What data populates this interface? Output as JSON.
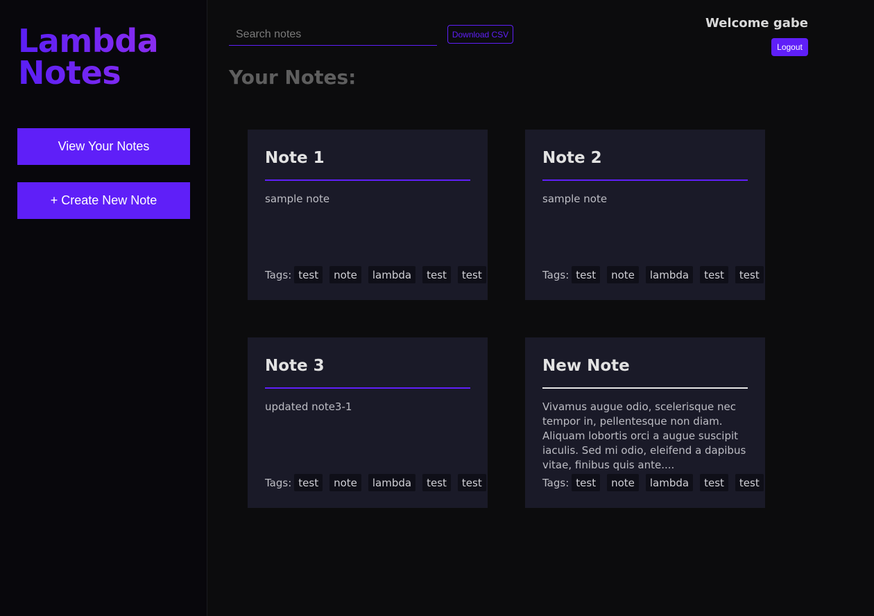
{
  "sidebar": {
    "logo_line1": "Lambda",
    "logo_line2": "Notes",
    "view_notes_label": "View Your Notes",
    "create_note_label": "+ Create New Note"
  },
  "header": {
    "search_placeholder": "Search notes",
    "download_csv_label": "Download CSV",
    "welcome_text": "Welcome gabe",
    "logout_label": "Logout"
  },
  "main": {
    "page_title": "Your Notes:",
    "tags_label": "Tags:",
    "notes": [
      {
        "title": "Note 1",
        "body": "sample note",
        "tags": [
          "test",
          "note",
          "lambda",
          "test",
          "test"
        ]
      },
      {
        "title": "Note 2",
        "body": "sample note",
        "tags": [
          "test",
          "note",
          "lambda",
          "test",
          "test"
        ]
      },
      {
        "title": "Note 3",
        "body": "updated note3-1",
        "tags": [
          "test",
          "note",
          "lambda",
          "test",
          "test"
        ]
      },
      {
        "title": "New Note",
        "body": "Vivamus augue odio, scelerisque nec tempor in, pellentesque non diam. Aliquam lobortis orci a augue suscipit iaculis. Sed mi odio, eleifend a dapibus vitae, finibus quis ante....",
        "tags": [
          "test",
          "note",
          "lambda",
          "test",
          "test"
        ]
      }
    ]
  },
  "colors": {
    "accent": "#5f1ff8",
    "background": "#0c0c0d",
    "sidebar": "#08070c",
    "card": "#1a1a28"
  }
}
